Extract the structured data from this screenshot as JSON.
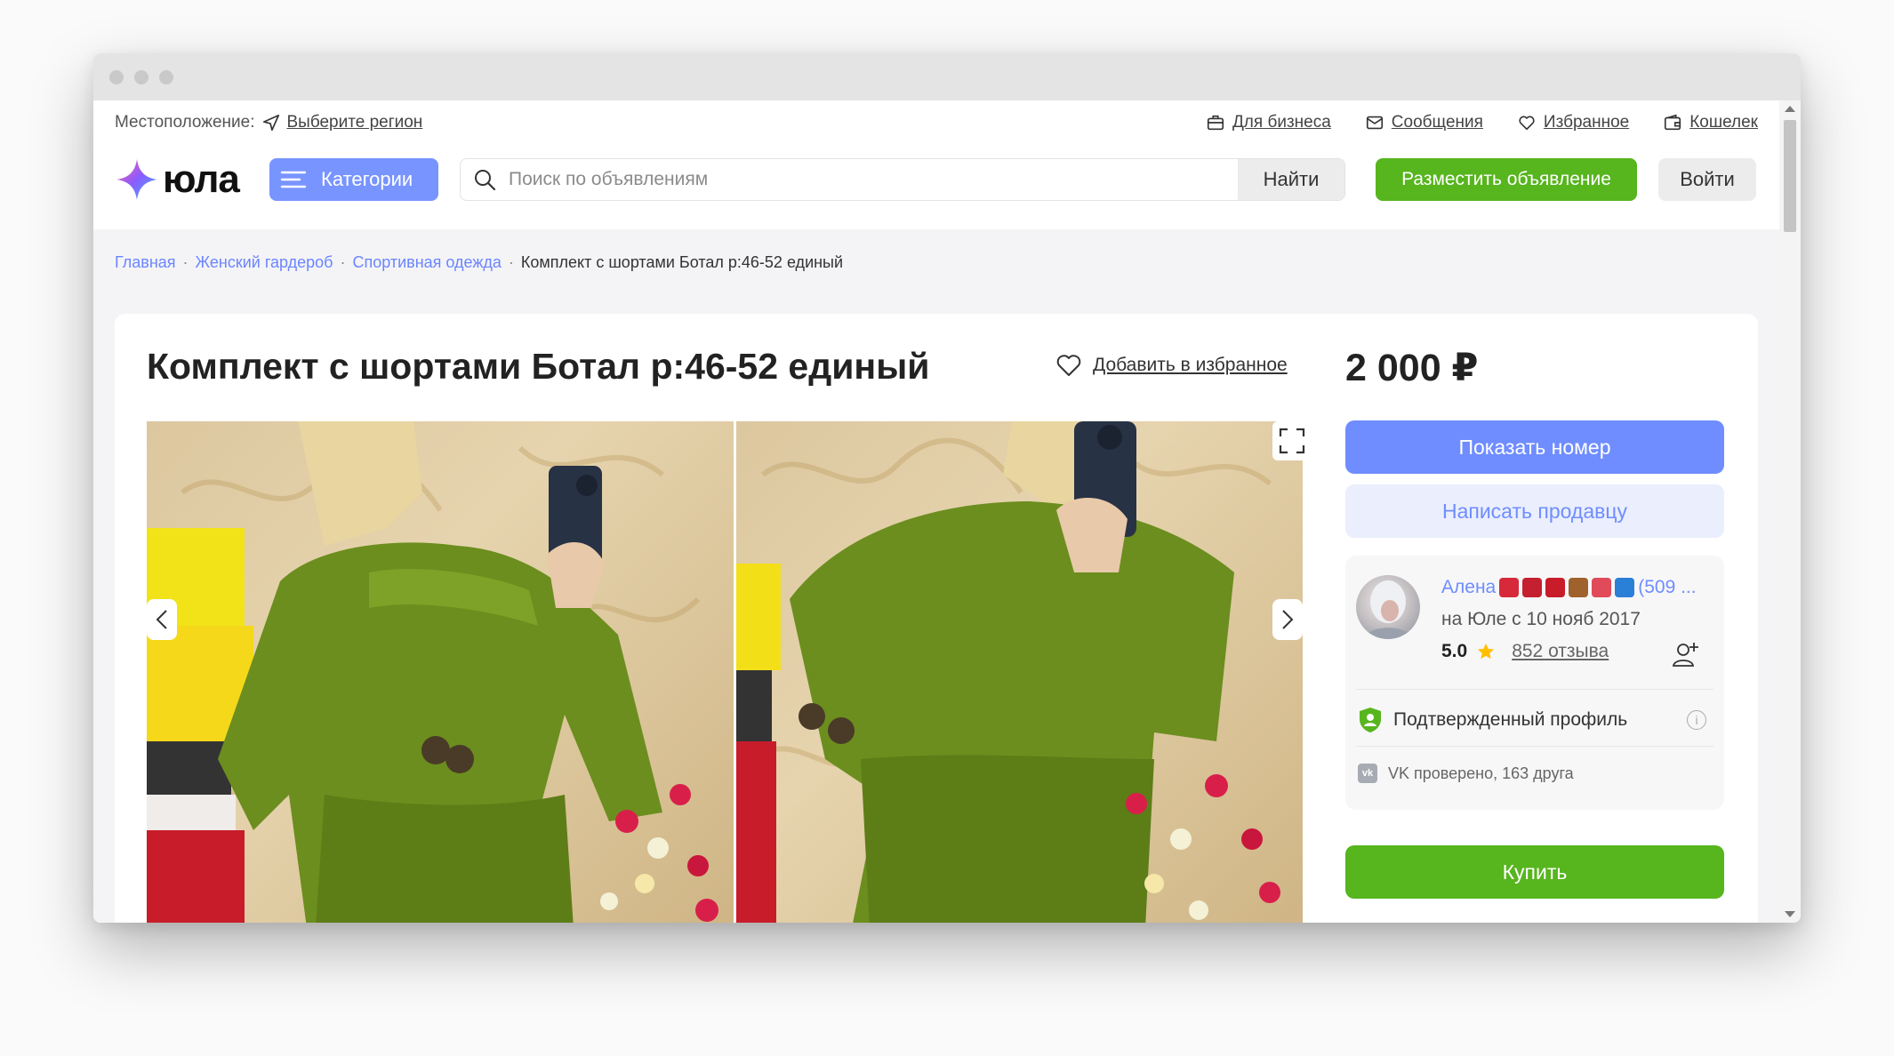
{
  "header": {
    "location_label": "Местоположение:",
    "location_link": "Выберите регион",
    "links": {
      "business": "Для бизнеса",
      "messages": "Сообщения",
      "favorites": "Избранное",
      "wallet": "Кошелек"
    },
    "logo_text": "юла",
    "categories_label": "Категории",
    "search_placeholder": "Поиск по объявлениям",
    "search_button": "Найти",
    "post_button": "Разместить объявление",
    "login_button": "Войти"
  },
  "breadcrumbs": {
    "items": [
      "Главная",
      "Женский гардероб",
      "Спортивная одежда"
    ],
    "separator": "·",
    "current": "Комплект с шортами Ботал р:46-52 единый"
  },
  "listing": {
    "title": "Комплект с шортами Ботал р:46-52 единый",
    "add_favorite": "Добавить в избранное",
    "price": "2 000 ₽",
    "show_phone": "Показать номер",
    "write_seller": "Написать продавцу",
    "buy": "Купить"
  },
  "seller": {
    "name": "Алена",
    "extra": "(509 ...",
    "since": "на Юле с 10 нояб 2017",
    "rating": "5.0",
    "reviews": "852 отзыва",
    "verified": "Подтвержденный профиль",
    "vk": "VK проверено, 163 друга",
    "vk_badge": "vk"
  },
  "colors": {
    "accent_blue": "#6f8dff",
    "accent_green": "#57b51e",
    "category_button": "#7894ff"
  },
  "icons": [
    "location-arrow-icon",
    "business-icon",
    "messages-icon",
    "heart-icon",
    "wallet-icon",
    "menu-icon",
    "search-icon",
    "expand-icon",
    "chevron-left-icon",
    "chevron-right-icon",
    "star-icon",
    "subscribe-icon",
    "shield-check-icon",
    "info-icon",
    "vk-icon"
  ]
}
